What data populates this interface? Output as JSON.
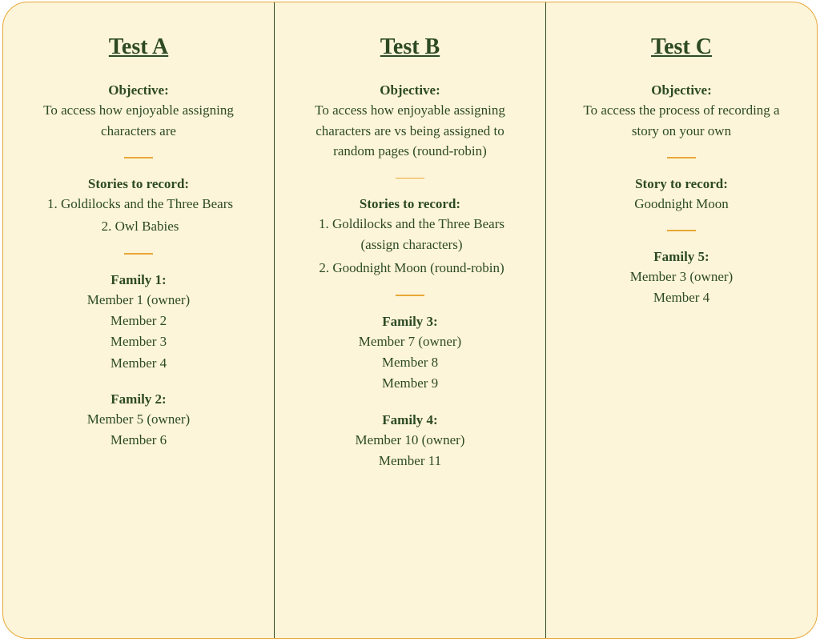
{
  "tests": [
    {
      "title": "Test A",
      "objectiveLabel": "Objective:",
      "objective": "To access how enjoyable assigning characters are",
      "storiesLabel": "Stories to record:",
      "stories": [
        "Goldilocks and the Three Bears",
        "Owl Babies"
      ],
      "families": [
        {
          "label": "Family 1:",
          "members": [
            "Member 1 (owner)",
            "Member 2",
            "Member 3",
            "Member 4"
          ]
        },
        {
          "label": "Family 2:",
          "members": [
            "Member 5 (owner)",
            "Member 6"
          ]
        }
      ]
    },
    {
      "title": "Test B",
      "objectiveLabel": "Objective:",
      "objective": "To access how enjoyable assigning characters are vs being assigned to random pages (round-robin)",
      "storiesLabel": "Stories to record:",
      "stories": [
        "Goldilocks and the Three Bears (assign characters)",
        "Goodnight Moon (round-robin)"
      ],
      "families": [
        {
          "label": "Family 3:",
          "members": [
            "Member 7 (owner)",
            "Member 8",
            "Member 9"
          ]
        },
        {
          "label": "Family 4:",
          "members": [
            "Member 10 (owner)",
            "Member 11"
          ]
        }
      ]
    },
    {
      "title": "Test C",
      "objectiveLabel": "Objective:",
      "objective": "To access the process of recording a story on your own",
      "storiesLabel": "Story to record:",
      "storySingle": "Goodnight Moon",
      "families": [
        {
          "label": "Family 5:",
          "members": [
            "Member 3 (owner)",
            "Member 4"
          ]
        }
      ]
    }
  ]
}
